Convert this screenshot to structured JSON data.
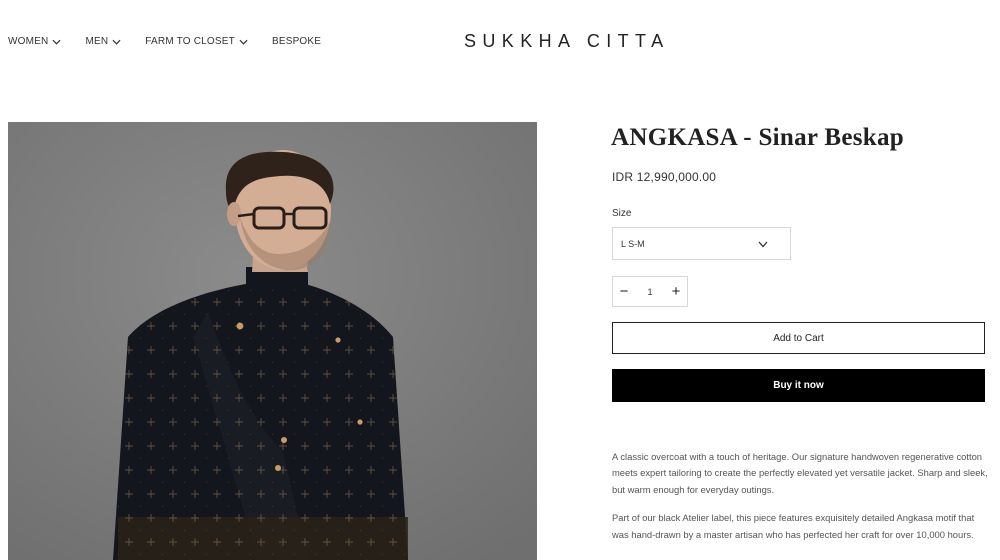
{
  "nav": {
    "items": [
      {
        "label": "WOMEN",
        "has_dropdown": true
      },
      {
        "label": "MEN",
        "has_dropdown": true
      },
      {
        "label": "FARM TO CLOSET",
        "has_dropdown": true
      },
      {
        "label": "BESPOKE",
        "has_dropdown": false
      }
    ],
    "brand": "SUKKHA CITTA"
  },
  "product": {
    "title": "ANGKASA - Sinar Beskap",
    "price": "IDR 12,990,000.00",
    "size_label": "Size",
    "size_selected": "L S-M",
    "quantity": "1",
    "qty_minus": "−",
    "qty_plus": "+",
    "add_to_cart": "Add to Cart",
    "buy_now": "Buy it now",
    "description": [
      "A classic overcoat with a touch of heritage. Our signature handwoven regenerative cotton meets expert tailoring to create the perfectly elevated yet versatile jacket. Sharp and sleek, but warm enough for everyday outings.",
      "Part of our black Atelier label, this piece features exquisitely detailed Angkasa motif that was hand-drawn by a master artisan who has perfected her craft for over 10,000 hours."
    ]
  },
  "colors": {
    "background": "#ffffff",
    "text": "#222222",
    "button_dark": "#000000",
    "photo_backdrop": "#7a7b7a",
    "jacket": "#14161d",
    "motif": "#c89a6a"
  },
  "icons": {
    "dropdown": "chevron-down-icon",
    "minus": "minus-icon",
    "plus": "plus-icon"
  }
}
